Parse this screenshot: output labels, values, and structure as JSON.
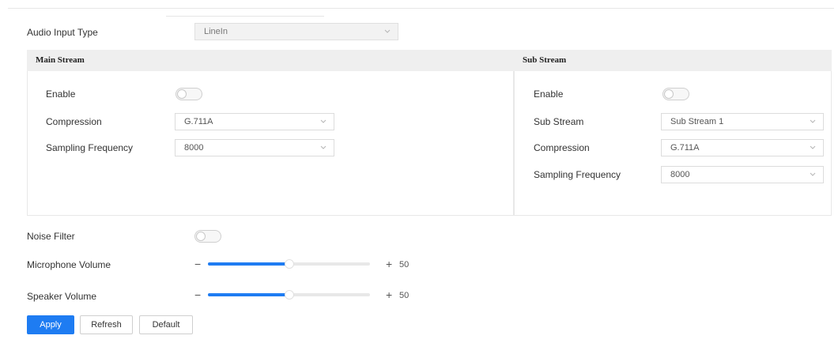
{
  "colors": {
    "accent": "#1e7cf2",
    "panel_header_bg": "#efefef",
    "border": "#dcdcdc"
  },
  "audio_input": {
    "label": "Audio Input Type",
    "value": "LineIn"
  },
  "main_stream": {
    "title": "Main Stream",
    "enable_label": "Enable",
    "enable_on": false,
    "compression_label": "Compression",
    "compression_value": "G.711A",
    "sampling_label": "Sampling Frequency",
    "sampling_value": "8000"
  },
  "sub_stream": {
    "title": "Sub Stream",
    "enable_label": "Enable",
    "enable_on": false,
    "substream_label": "Sub Stream",
    "substream_value": "Sub Stream 1",
    "compression_label": "Compression",
    "compression_value": "G.711A",
    "sampling_label": "Sampling Frequency",
    "sampling_value": "8000"
  },
  "noise_filter": {
    "label": "Noise Filter",
    "on": false
  },
  "microphone_volume": {
    "label": "Microphone Volume",
    "minus": "−",
    "plus": "+",
    "value": 50,
    "min": 0,
    "max": 100
  },
  "speaker_volume": {
    "label": "Speaker Volume",
    "minus": "−",
    "plus": "+",
    "value": 50,
    "min": 0,
    "max": 100
  },
  "buttons": {
    "apply": "Apply",
    "refresh": "Refresh",
    "default": "Default"
  },
  "icons": {
    "select_chevron": "chevron-down-icon"
  }
}
